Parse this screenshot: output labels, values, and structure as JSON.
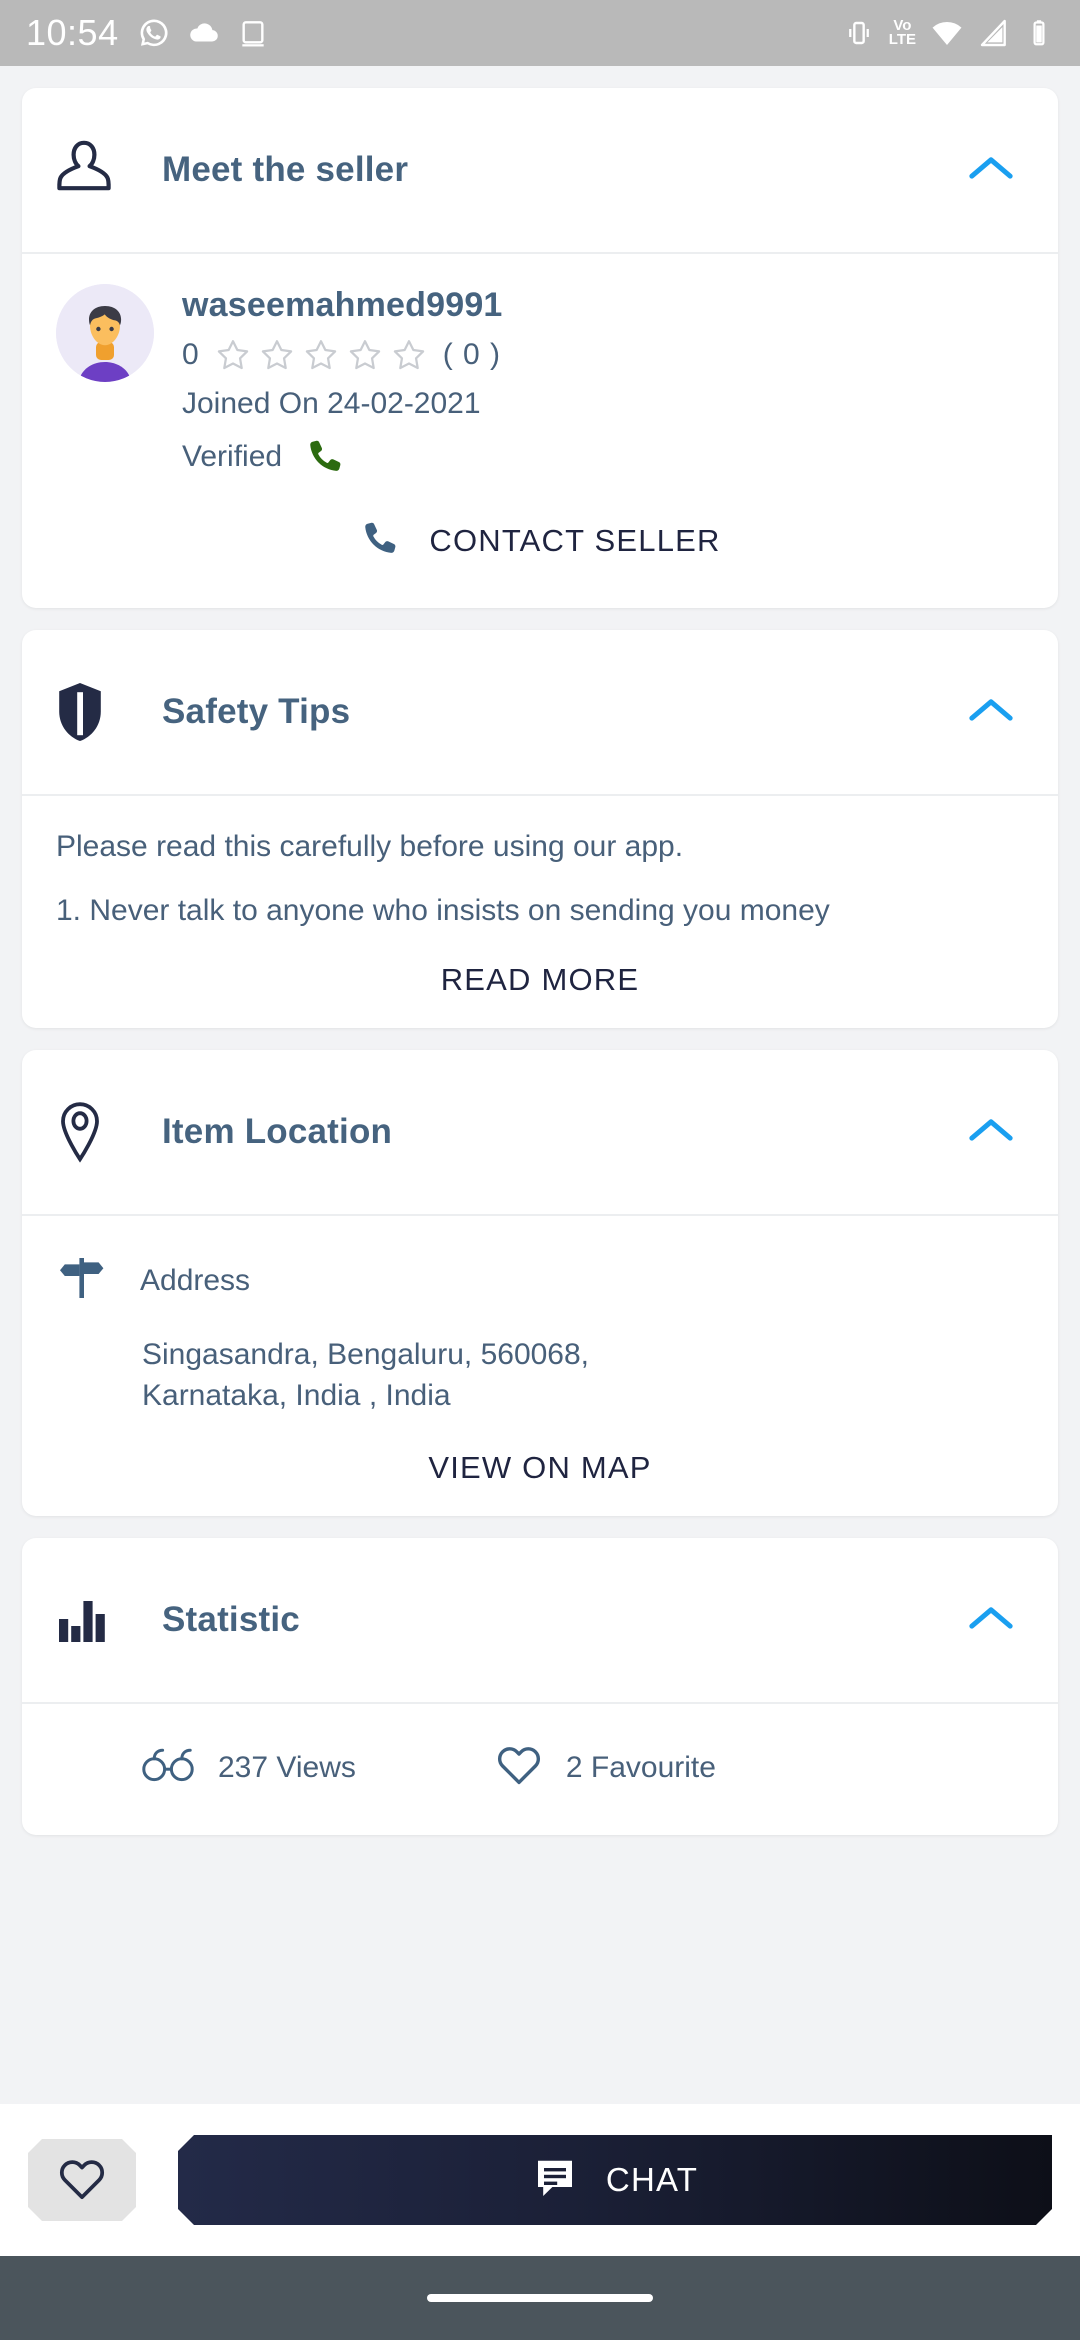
{
  "status_bar": {
    "time": "10:54",
    "left_icons": [
      "whatsapp-icon",
      "cloud-icon",
      "screencast-icon"
    ],
    "right_icons": [
      "vibrate-icon",
      "volte-icon",
      "wifi-icon",
      "signal-icon",
      "battery-icon"
    ],
    "volte_top": "Vo",
    "volte_bottom": "LTE"
  },
  "seller_section": {
    "title": "Meet the seller",
    "icon": "person-outline-icon",
    "collapse_icon": "chevron-up-icon",
    "name": "waseemahmed9991",
    "rating_value": "0",
    "stars": 5,
    "rating_count": "( 0 )",
    "joined": "Joined On 24-02-2021",
    "verified_label": "Verified",
    "verified_icon": "phone-green-icon",
    "contact_button": "CONTACT SELLER",
    "contact_icon": "phone-icon"
  },
  "safety_section": {
    "title": "Safety Tips",
    "icon": "shield-icon",
    "collapse_icon": "chevron-up-icon",
    "intro": "Please read this carefully before using our app.",
    "tip_1": "1. Never talk to anyone who insists on sending you money",
    "read_more": "READ MORE"
  },
  "location_section": {
    "title": "Item Location",
    "icon": "map-pin-icon",
    "collapse_icon": "chevron-up-icon",
    "address_label": "Address",
    "address_icon": "signpost-icon",
    "address_value": "Singasandra, Bengaluru, 560068, Karnataka, India , India",
    "view_on_map": "VIEW ON MAP"
  },
  "statistic_section": {
    "title": "Statistic",
    "icon": "bar-chart-icon",
    "collapse_icon": "chevron-up-icon",
    "views": "237 Views",
    "views_icon": "glasses-icon",
    "favourites": "2 Favourite",
    "favourites_icon": "heart-outline-icon"
  },
  "bottom_bar": {
    "favourite_icon": "heart-outline-icon",
    "chat_label": "CHAT",
    "chat_icon": "chat-bubble-icon"
  },
  "colors": {
    "title_blue": "#46637f",
    "body_blue": "#48607a",
    "accent_chevron": "#1a9ff0",
    "dark_navy": "#1f2440",
    "green_phone": "#2c6b10",
    "status_bar_bg": "#b9b9b9",
    "page_bg": "#f2f3f5",
    "nav_bg": "#4b555c"
  }
}
